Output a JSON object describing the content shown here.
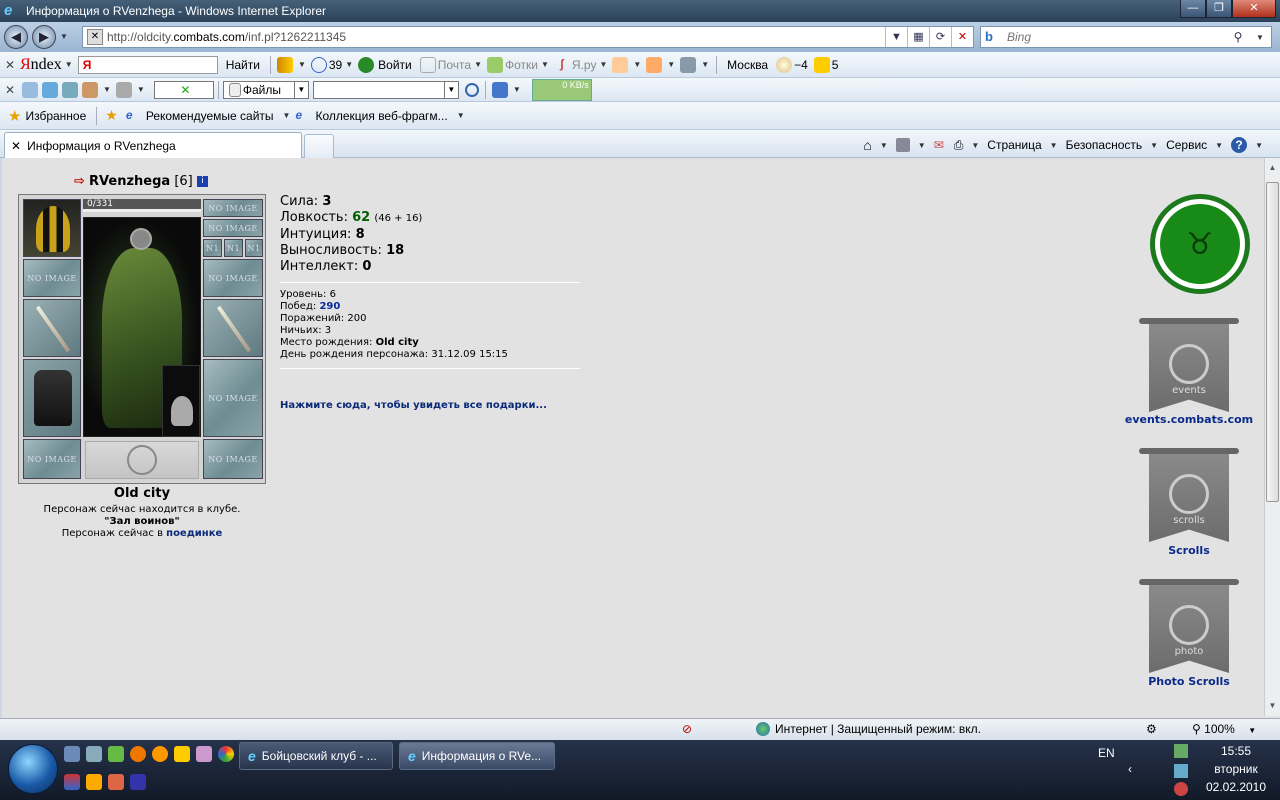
{
  "window": {
    "title": "Информация о RVenzhega - Windows Internet Explorer",
    "minimize": "—",
    "maximize": "❐",
    "close": "✕"
  },
  "address": {
    "url_prefix": "http://oldcity.",
    "url_domain": "combats.com",
    "url_path": "/inf.pl?1262211345"
  },
  "search": {
    "placeholder": "Bing"
  },
  "yandex_bar": {
    "brand_first": "Я",
    "brand_rest": "ndex",
    "input_logo": "Я",
    "find": "Найти",
    "messages_count": "39",
    "login": "Войти",
    "mail": "Почта",
    "photos": "Фотки",
    "yaru": "Я.ру",
    "city": "Москва",
    "temperature": "−4",
    "traffic": "5"
  },
  "toolbar2": {
    "files": "Файлы",
    "speed": "0 KB/s"
  },
  "favorites_bar": {
    "favorites": "Избранное",
    "recommended": "Рекомендуемые сайты",
    "gallery": "Коллекция веб-фрагм..."
  },
  "tab": {
    "title": "Информация о RVenzhega"
  },
  "commandbar": {
    "page": "Страница",
    "safety": "Безопасность",
    "tools": "Сервис"
  },
  "character": {
    "name": "RVenzhega",
    "level_bracket": "[6]",
    "hp": "0/331",
    "city": "Old city",
    "status_line1": "Персонаж сейчас находится в клубе.",
    "status_club": "\"Зал воинов\"",
    "status_line2": "Персонаж сейчас в",
    "status_link": "поединке",
    "slots": {
      "noimage": "NO IMAGE",
      "ring": "N1"
    }
  },
  "stats": {
    "strength_label": "Сила:",
    "strength": "3",
    "agility_label": "Ловкость:",
    "agility": "62",
    "agility_detail": "(46 + 16)",
    "intuition_label": "Интуиция:",
    "intuition": "8",
    "endurance_label": "Выносливость:",
    "endurance": "18",
    "intellect_label": "Интеллект:",
    "intellect": "0"
  },
  "info": {
    "level_label": "Уровень:",
    "level": "6",
    "wins_label": "Побед:",
    "wins": "290",
    "losses_label": "Поражений:",
    "losses": "200",
    "draws_label": "Ничьих:",
    "draws": "3",
    "birthplace_label": "Место рождения:",
    "birthplace": "Old city",
    "birthday_label": "День рождения персонажа:",
    "birthday": "31.12.09 15:15"
  },
  "gifts_link": "Нажмите сюда, чтобы увидеть все подарки...",
  "banners": [
    {
      "word": "events",
      "label": "events.combats.com"
    },
    {
      "word": "scrolls",
      "label": "Scrolls"
    },
    {
      "word": "photo",
      "label": "Photo Scrolls"
    }
  ],
  "statusbar": {
    "zone": "Интернет | Защищенный режим: вкл.",
    "zoom": "100%"
  },
  "taskbar": {
    "task1": "Бойцовский клуб - ...",
    "task2": "Информация о RVe...",
    "lang": "EN",
    "time": "15:55",
    "day": "вторник",
    "date": "02.02.2010"
  }
}
